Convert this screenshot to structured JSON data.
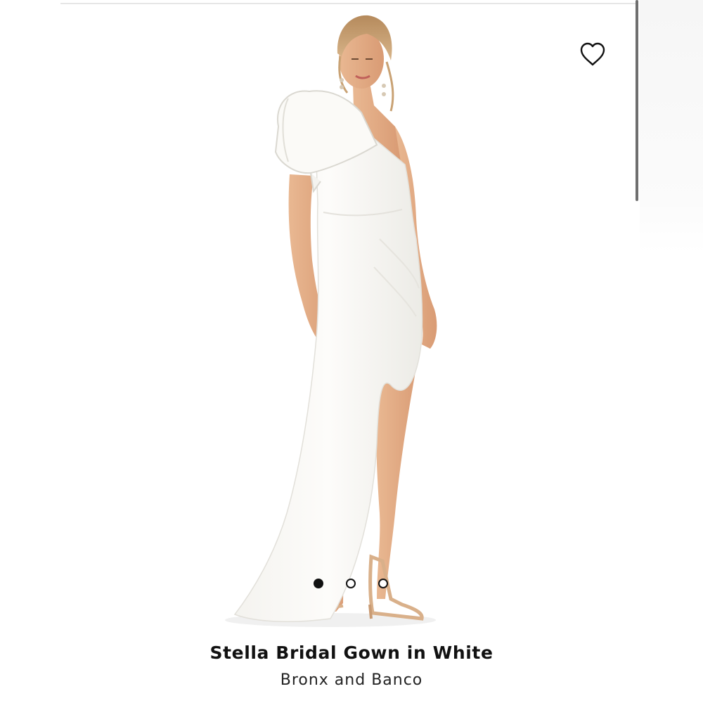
{
  "product": {
    "name": "Stella Bridal Gown in White",
    "brand": "Bronx and Banco"
  },
  "gallery": {
    "image_subject": "model-wearing-gown",
    "active_index": 0,
    "slide_count": 3
  },
  "wishlist": {
    "icon": "heart-outline-icon"
  },
  "colors": {
    "text": "#111111",
    "dot_active": "#111111",
    "divider": "#e6e6e6",
    "scrollbar": "#6f6f6f"
  }
}
